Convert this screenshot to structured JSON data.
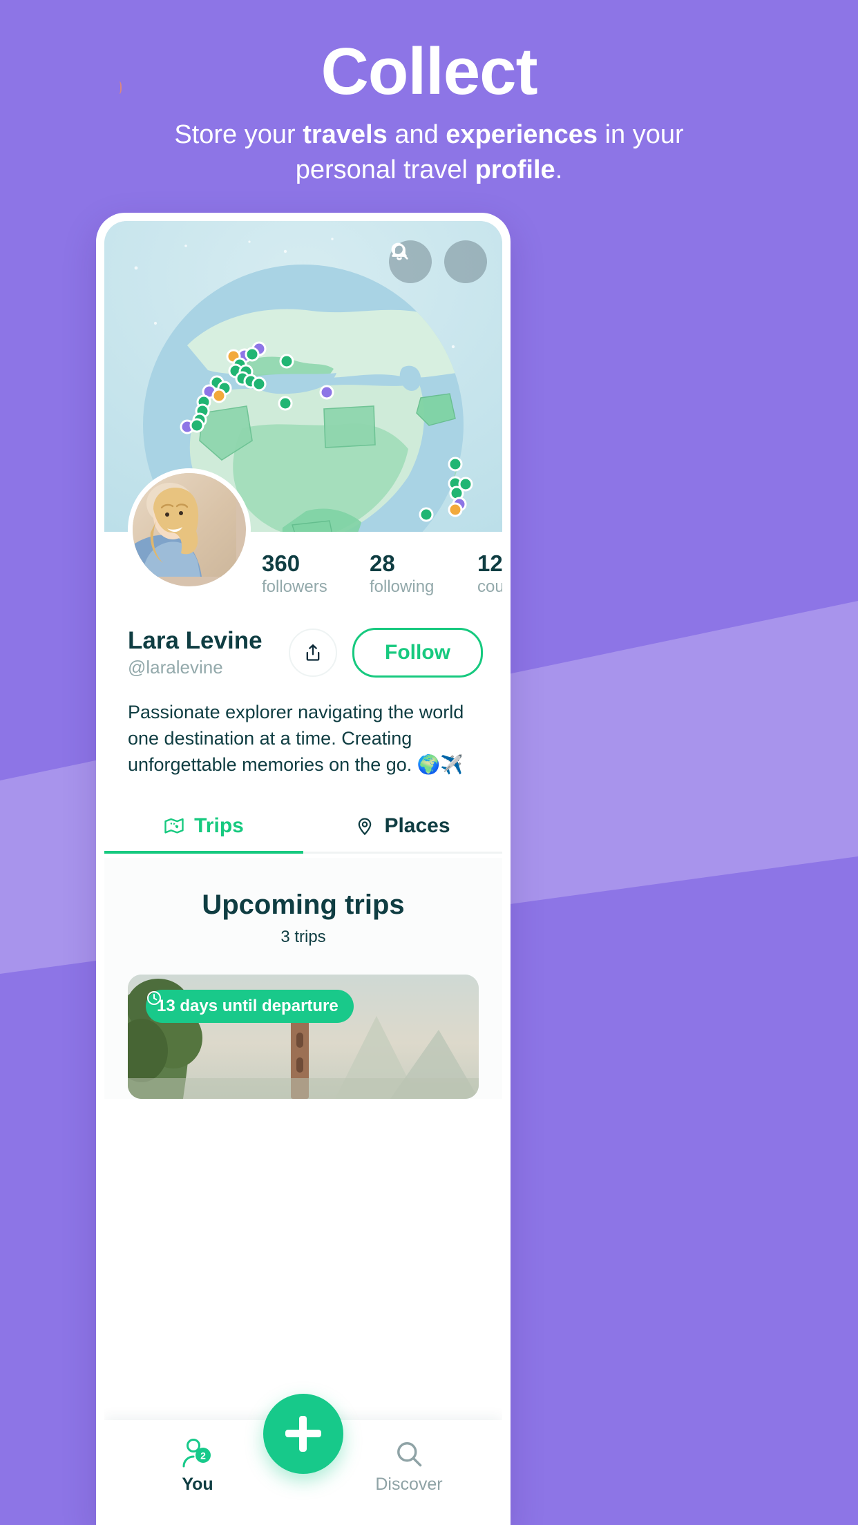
{
  "hero": {
    "title": "Collect",
    "subtitle_parts": [
      {
        "text": "Store your ",
        "bold": false
      },
      {
        "text": "travels",
        "bold": true
      },
      {
        "text": " and ",
        "bold": false
      },
      {
        "text": "experiences",
        "bold": true
      },
      {
        "text": " in your personal travel ",
        "bold": false
      },
      {
        "text": "profile",
        "bold": true
      },
      {
        "text": ".",
        "bold": false
      }
    ],
    "subtitle_plain": "Store your travels and experiences in your personal travel profile."
  },
  "colors": {
    "background_purple": "#8d75e6",
    "band_purple": "#a894ec",
    "accent_green": "#17c98a",
    "follow_green": "#17c97f",
    "dark_teal": "#0f3d42",
    "muted_teal": "#93a9ab",
    "map_sea": "#a9d3e4",
    "map_land": "#bfe7cf"
  },
  "phone": {
    "header": {
      "search_icon": "search-icon",
      "notifications_icon": "bell-icon"
    },
    "stats": [
      {
        "value": "360",
        "label": "followers"
      },
      {
        "value": "28",
        "label": "following"
      },
      {
        "value": "12",
        "label": "countries"
      }
    ],
    "profile": {
      "name": "Lara Levine",
      "handle": "@laralevine",
      "bio": "Passionate explorer navigating the world one destination at a time. Creating unforgettable memories on the go. 🌍✈️",
      "share_icon": "share-icon",
      "follow_label": "Follow"
    },
    "tabs": [
      {
        "label": "Trips",
        "icon": "map-icon",
        "active": true
      },
      {
        "label": "Places",
        "icon": "pin-icon",
        "active": false
      }
    ],
    "upcoming": {
      "title": "Upcoming trips",
      "count_label": "3 trips",
      "card_badge": "13 days until departure",
      "card_badge_icon": "clock-icon"
    },
    "bottom_nav": {
      "you": {
        "label": "You",
        "icon": "person-icon",
        "badge": "2"
      },
      "add": {
        "icon": "plus-icon"
      },
      "discover": {
        "label": "Discover",
        "icon": "search-icon"
      }
    }
  }
}
